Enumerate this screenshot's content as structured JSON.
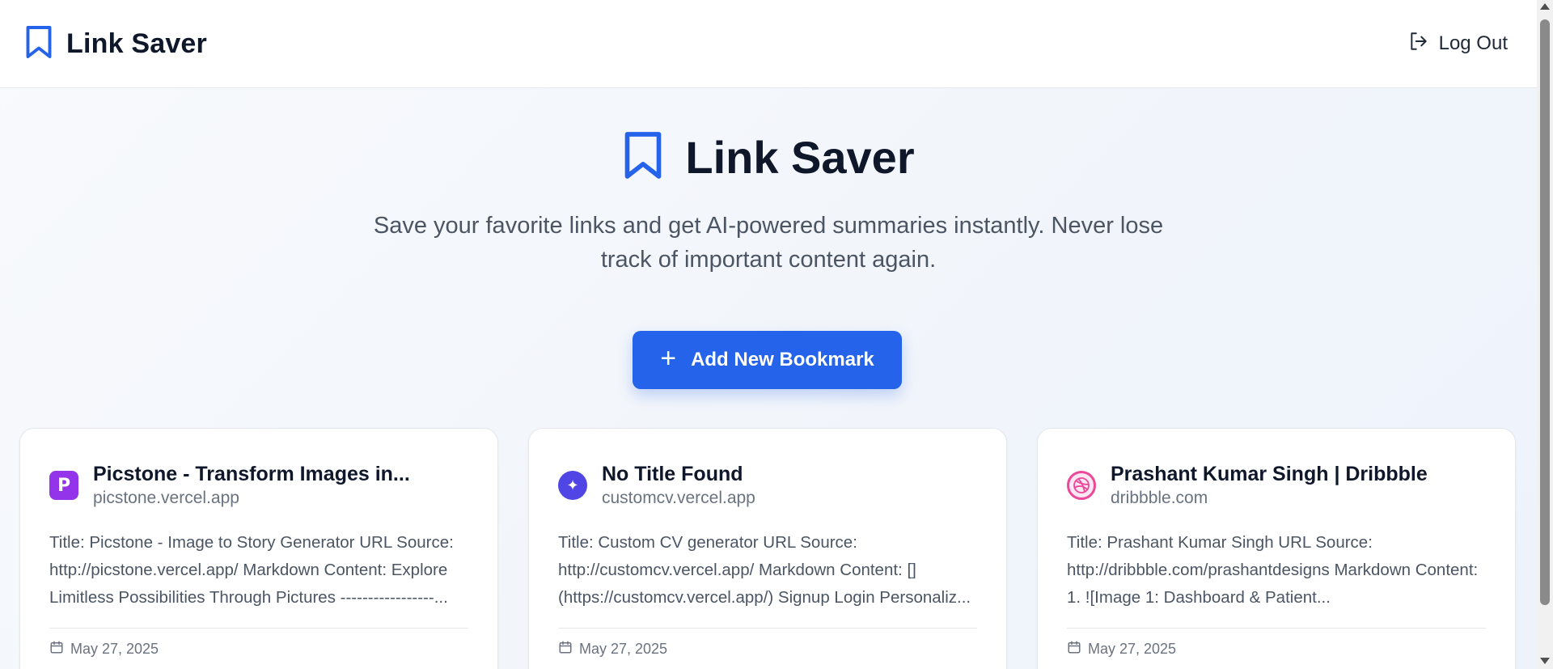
{
  "navbar": {
    "brand": "Link Saver",
    "logout_label": "Log Out"
  },
  "hero": {
    "title": "Link Saver",
    "subtitle": "Save your favorite links and get AI-powered summaries instantly. Never lose track of important content again."
  },
  "actions": {
    "add_label": "Add New Bookmark"
  },
  "bookmarks": [
    {
      "title": "Picstone - Transform Images in...",
      "domain": "picstone.vercel.app",
      "summary": "Title: Picstone - Image to Story Generator URL Source: http://picstone.vercel.app/ Markdown Content: Explore Limitless Possibilities Through Pictures -----------------...",
      "date": "May 27, 2025",
      "favicon": "P"
    },
    {
      "title": "No Title Found",
      "domain": "customcv.vercel.app",
      "summary": "Title: Custom CV generator URL Source: http://customcv.vercel.app/ Markdown Content: [](https://customcv.vercel.app/) Signup Login Personaliz...",
      "date": "May 27, 2025",
      "favicon": "✦"
    },
    {
      "title": "Prashant Kumar Singh | Dribbble",
      "domain": "dribbble.com",
      "summary": "Title: Prashant Kumar Singh URL Source: http://dribbble.com/prashantdesigns Markdown Content: 1. ![Image 1: Dashboard & Patient...",
      "date": "May 27, 2025",
      "favicon": "dribbble-icon"
    }
  ],
  "colors": {
    "accent": "#2563eb",
    "text_primary": "#0f172a",
    "text_secondary": "#4b5563",
    "text_muted": "#6b7280",
    "card_border": "#e5e7eb"
  }
}
